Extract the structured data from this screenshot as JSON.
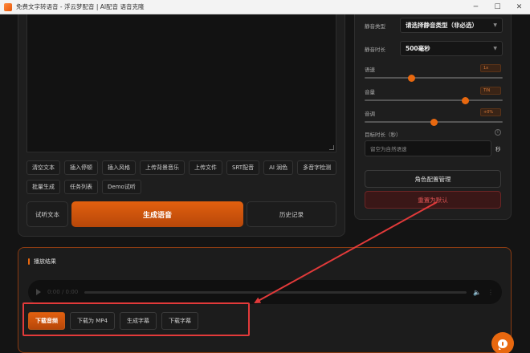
{
  "window": {
    "title": "免费文字转语音 - 浮云梦配音 | AI配音 语音克隆",
    "minimize": "─",
    "maximize": "☐",
    "close": "✕"
  },
  "toolbar": {
    "row1": [
      "清空文本",
      "插入停顿",
      "插入风格",
      "上传背景音乐",
      "上传文件",
      "SRT配音",
      "AI 润色",
      "多音字检测"
    ],
    "row2": [
      "批量生成",
      "任务列表",
      "Demo试听"
    ]
  },
  "actions": {
    "listen": "试听文本",
    "generate": "生成语音",
    "history": "历史记录"
  },
  "settings": {
    "silence_type_label": "静音类型",
    "silence_type_value": "请选择静音类型（非必选）",
    "silence_duration_label": "静音时长",
    "silence_duration_value": "500毫秒",
    "speed_label": "语速",
    "speed_value": "1x",
    "speed_level": 0.34,
    "volume_label": "音量",
    "volume_value": "TIN",
    "volume_level": 0.73,
    "pitch_label": "音调",
    "pitch_value": "+0%",
    "pitch_level": 0.5,
    "target_duration_label": "目标时长（秒）",
    "target_duration_placeholder": "留空为自然语速",
    "target_duration_unit": "秒",
    "info_icon": "i",
    "role_config": "角色配置管理",
    "reset": "重置为默认"
  },
  "playback": {
    "title": "播放结果",
    "time": "0:00 / 0:00",
    "downloads": [
      "下载音频",
      "下载为 MP4",
      "生成字幕",
      "下载字幕"
    ]
  },
  "colors": {
    "accent": "#e8680f",
    "annotation": "#e23a3a"
  }
}
